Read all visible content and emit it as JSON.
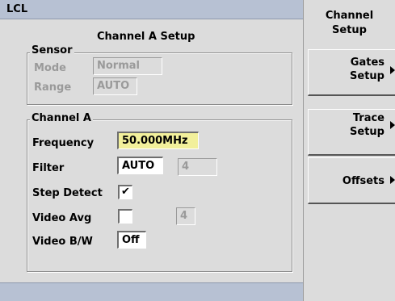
{
  "topbar": {
    "label": "LCL"
  },
  "main": {
    "title": "Channel A Setup",
    "sensor": {
      "label": "Sensor",
      "mode_label": "Mode",
      "mode_value": "Normal",
      "range_label": "Range",
      "range_value": "AUTO"
    },
    "channel": {
      "label": "Channel A",
      "frequency_label": "Frequency",
      "frequency_value": "50.000MHz",
      "filter_label": "Filter",
      "filter_value": "AUTO",
      "filter_count": "4",
      "step_detect_label": "Step Detect",
      "step_detect_mark": "✔",
      "video_avg_label": "Video Avg",
      "video_avg_mark": "",
      "video_avg_count": "4",
      "video_bw_label": "Video B/W",
      "video_bw_value": "Off"
    }
  },
  "softkeys": {
    "title_line1": "Channel",
    "title_line2": "Setup",
    "gates_line1": "Gates",
    "gates_line2": "Setup",
    "trace_line1": "Trace",
    "trace_line2": "Setup",
    "offsets": "Offsets"
  }
}
